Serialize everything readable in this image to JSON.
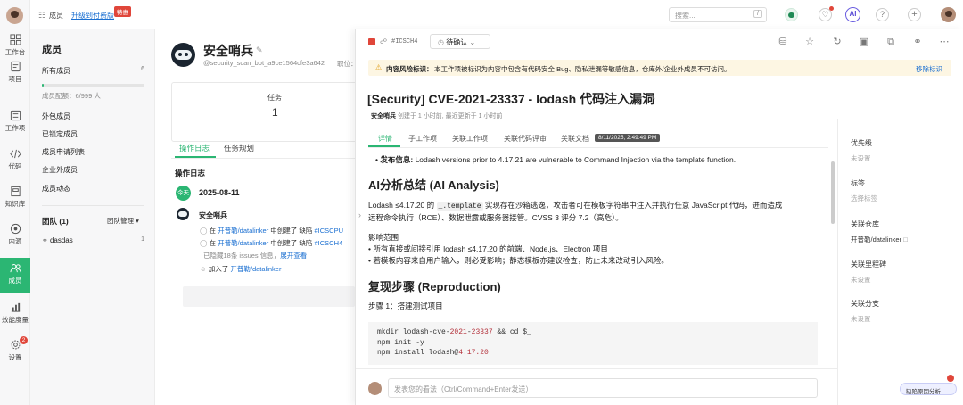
{
  "nav": {
    "items": [
      {
        "label": "工作台",
        "icon": "dashboard-icon"
      },
      {
        "label": "项目",
        "icon": "project-icon"
      },
      {
        "label": "工作项",
        "icon": "workitem-icon"
      },
      {
        "label": "代码",
        "icon": "code-icon"
      },
      {
        "label": "知识库",
        "icon": "knowledge-icon"
      },
      {
        "label": "内源",
        "icon": "innersource-icon"
      },
      {
        "label": "成员",
        "icon": "members-icon"
      },
      {
        "label": "效能度量",
        "icon": "metrics-icon"
      },
      {
        "label": "设置",
        "icon": "settings-icon"
      }
    ],
    "settings_badge": "2"
  },
  "topbar": {
    "section": "成员",
    "upgrade_link": "升级到付费版",
    "promo_badge": "特惠",
    "search_placeholder": "搜索...",
    "search_shortcut": "/",
    "ai_label": "AI"
  },
  "sidebar": {
    "title": "成员",
    "all_members": "所有成员",
    "all_members_count": "6",
    "quota": "成员配额：6/999 人",
    "links": [
      "外包成员",
      "已锁定成员",
      "成员申请列表",
      "企业外成员",
      "成员动态"
    ],
    "team_header": "团队 (1)",
    "team_manage": "团队管理",
    "teams": [
      {
        "name": "dasdas",
        "count": "1"
      }
    ]
  },
  "profile": {
    "name": "安全哨兵",
    "handle": "@security_scan_bot_a9ce1564cfe3a642",
    "role_label": "职位：",
    "task_label": "任务",
    "task_count": "1",
    "tabs": [
      "操作日志",
      "任务规划"
    ],
    "log_title": "操作日志",
    "today_badge": "今天",
    "date": "2025-08-11",
    "actor": "安全哨兵",
    "entries": [
      {
        "prefix": "在",
        "repo": "开普勒/datalinker",
        "verb": "中创建了",
        "type": "缺陷",
        "id": "#ICSCPU"
      },
      {
        "prefix": "在",
        "repo": "开普勒/datalinker",
        "verb": "中创建了",
        "type": "缺陷",
        "id": "#ICSCH4"
      }
    ],
    "hidden_note": "已隐藏18条 issues 信息，",
    "expand": "展开查看",
    "joined_prefix": "加入了",
    "joined_repo": "开普勒/datalinker"
  },
  "panel": {
    "issue_tag": "#ICSCH4",
    "status": "待确认",
    "risk_label": "内容风险标识：",
    "risk_text": "本工作项被标识为内容中包含有代码安全 Bug、隐私泄漏等敏感信息，仓库外/企业外成员不可访问。",
    "risk_remove": "移除标识",
    "title": "[Security] CVE-2021-23337 - lodash 代码注入漏洞",
    "author": "安全哨兵",
    "meta": "创建于 1 小时前, 最近更新于 1 小时前",
    "tabs": [
      "详情",
      "子工作项",
      "关联工作项",
      "关联代码评审",
      "关联文档"
    ],
    "tooltip": "8/11/2025, 2:49:49 PM",
    "pub_label": "发布信息:",
    "pub_text": "Lodash versions prior to 4.17.21 are vulnerable to Command Injection via the template function.",
    "ai_heading": "AI分析总结 (AI Analysis)",
    "ai_p1_a": "Lodash ≤4.17.20 的",
    "ai_p1_code": "_.template",
    "ai_p1_b": "实现存在沙箱逃逸，攻击者可在模板字符串中注入并执行任意 JavaScript 代码，进而造成",
    "ai_p1_c": "远程命令执行（RCE）、数据泄露或服务器接管。CVSS 3 评分 7.2（高危）。",
    "impact_title": "影响范围",
    "impact_1": "• 所有直接或间接引用 lodash ≤4.17.20 的前端、Node.js、Electron 项目",
    "impact_2": "• 若模板内容来自用户输入，则必受影响；静态模板亦建议检查，防止未来改动引入风险。",
    "repro_heading": "复现步骤 (Reproduction)",
    "step1": "步骤 1：搭建测试项目",
    "code": {
      "l1a": "mkdir lodash-cve-",
      "l1b": "2021",
      "l1c": "-",
      "l1d": "23337",
      "l1e": " && cd $_",
      "l2": "npm init -y",
      "l3a": "npm install lodash@",
      "l3b": "4.17.20"
    },
    "comment_placeholder": "发表您的看法（Ctrl/Command+Enter发送）",
    "fields": [
      {
        "label": "优先级",
        "value": "未设置"
      },
      {
        "label": "标签",
        "value": "选择标签"
      },
      {
        "label": "关联仓库",
        "value": "开普勒/datalinker"
      },
      {
        "label": "关联里程碑",
        "value": "未设置"
      },
      {
        "label": "关联分支",
        "value": "未设置"
      }
    ],
    "float_btn": "缺陷原因分析"
  },
  "colors": {
    "accent": "#2bb673",
    "link": "#1a6fd1",
    "danger": "#e0463a",
    "warn_bg": "#fdf6e3"
  }
}
